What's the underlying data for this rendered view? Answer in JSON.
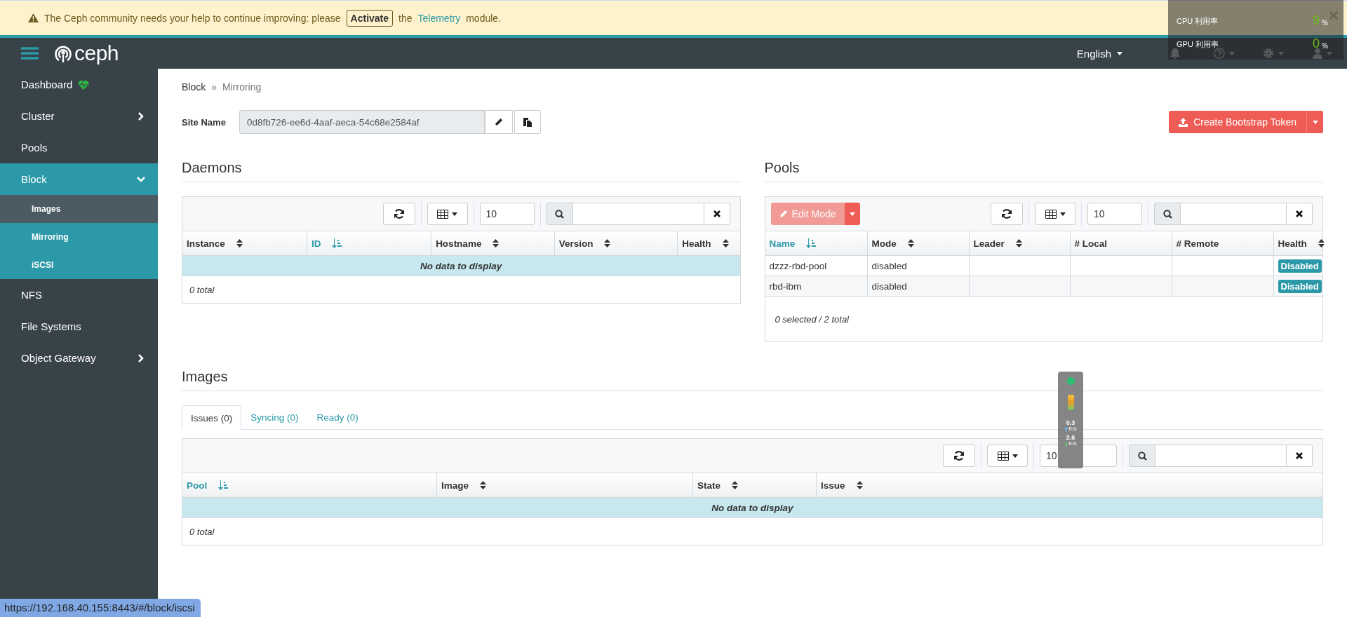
{
  "alert": {
    "text": "The Ceph community needs your help to continue improving: please",
    "button": "Activate",
    "middle": "the",
    "link": "Telemetry",
    "after": "module."
  },
  "navbar": {
    "logo": "ceph",
    "language": "English"
  },
  "sidebar": {
    "items": [
      {
        "label": "Dashboard",
        "kind": "status",
        "selected": false
      },
      {
        "label": "Cluster",
        "kind": "group",
        "selected": false,
        "expanded": false
      },
      {
        "label": "Pools",
        "kind": "link",
        "selected": false
      },
      {
        "label": "Block",
        "kind": "group",
        "selected": true,
        "expanded": true,
        "children": [
          {
            "label": "Images",
            "selected": true
          },
          {
            "label": "Mirroring",
            "selected": false
          },
          {
            "label": "iSCSI",
            "selected": false
          }
        ]
      },
      {
        "label": "NFS",
        "kind": "link",
        "selected": false
      },
      {
        "label": "File Systems",
        "kind": "link",
        "selected": false
      },
      {
        "label": "Object Gateway",
        "kind": "group",
        "selected": false,
        "expanded": false
      }
    ]
  },
  "breadcrumb": {
    "items": [
      "Block",
      "Mirroring"
    ],
    "separator": "»"
  },
  "site": {
    "label": "Site Name",
    "value": "0d8fb726-ee6d-4aaf-aeca-54c68e2584af",
    "create_button": "Create Bootstrap Token"
  },
  "daemons": {
    "title": "Daemons",
    "page_size": "10",
    "columns": [
      {
        "label": "Instance",
        "sortable": true,
        "sorted": false
      },
      {
        "label": "ID",
        "sortable": true,
        "sorted": true
      },
      {
        "label": "Hostname",
        "sortable": true,
        "sorted": false
      },
      {
        "label": "Version",
        "sortable": true,
        "sorted": false
      },
      {
        "label": "Health",
        "sortable": true,
        "sorted": false
      }
    ],
    "empty_text": "No data to display",
    "footer": "0 total"
  },
  "pools": {
    "title": "Pools",
    "edit_button": {
      "label": "Edit Mode",
      "disabled": true
    },
    "page_size": "10",
    "columns": [
      {
        "label": "Name",
        "sortable": true,
        "sorted": true
      },
      {
        "label": "Mode",
        "sortable": true,
        "sorted": false
      },
      {
        "label": "Leader",
        "sortable": true,
        "sorted": false
      },
      {
        "label": "# Local",
        "sortable": false,
        "sorted": false
      },
      {
        "label": "# Remote",
        "sortable": false,
        "sorted": false
      },
      {
        "label": "Health",
        "sortable": true,
        "sorted": false
      }
    ],
    "rows": [
      {
        "name": "dzzz-rbd-pool",
        "mode": "disabled",
        "health": "Disabled"
      },
      {
        "name": "rbd-ibm",
        "mode": "disabled",
        "health": "Disabled"
      }
    ],
    "footer": "0 selected / 2 total"
  },
  "images": {
    "title": "Images",
    "tabs": [
      {
        "label": "Issues (0)",
        "selected": true
      },
      {
        "label": "Syncing (0)",
        "selected": false
      },
      {
        "label": "Ready (0)",
        "selected": false
      }
    ],
    "page_size": "10",
    "columns": [
      {
        "label": "Pool",
        "sortable": true,
        "sorted": true
      },
      {
        "label": "Image",
        "sortable": true,
        "sorted": false
      },
      {
        "label": "State",
        "sortable": true,
        "sorted": false
      },
      {
        "label": "Issue",
        "sortable": true,
        "sorted": false
      }
    ],
    "empty_text": "No data to display",
    "footer": "0 total"
  },
  "monitor_overlay": {
    "rows": [
      {
        "label": "CPU 利用率",
        "value": "9",
        "unit": "%"
      },
      {
        "label": "GPU 利用率",
        "value": "0",
        "unit": "%"
      }
    ]
  },
  "speed_widget": {
    "up": "0.3",
    "up_unit": "K/s",
    "down": "2.6",
    "down_unit": "K/s"
  },
  "status_url": "https://192.168.40.155:8443/#/block/iscsi"
}
